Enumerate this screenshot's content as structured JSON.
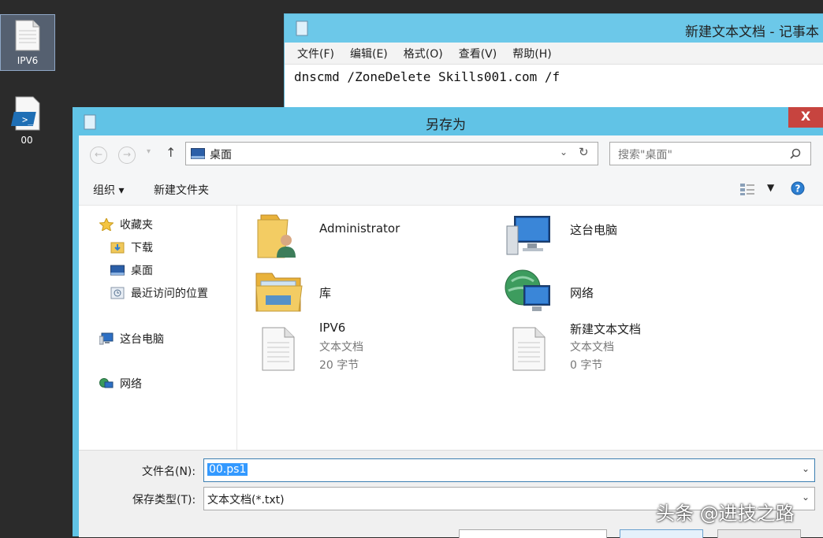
{
  "desktop": {
    "icons": [
      {
        "label": "IPV6",
        "icon": "text-file-icon"
      },
      {
        "label": "00",
        "icon": "powershell-file-icon"
      }
    ]
  },
  "notepad": {
    "title": "新建文本文档 - 记事本",
    "menu": [
      "文件(F)",
      "编辑(E)",
      "格式(O)",
      "查看(V)",
      "帮助(H)"
    ],
    "content": "dnscmd /ZoneDelete Skills001.com /f"
  },
  "dialog": {
    "title": "另存为",
    "close_label": "X",
    "address": "桌面",
    "search_placeholder": "搜索\"桌面\"",
    "toolbar": {
      "organize": "组织 ▾",
      "new_folder": "新建文件夹"
    },
    "nav": {
      "favorites": "收藏夹",
      "downloads": "下载",
      "desktop": "桌面",
      "recent": "最近访问的位置",
      "this_pc": "这台电脑",
      "network": "网络"
    },
    "items": [
      {
        "name": "Administrator"
      },
      {
        "name": "这台电脑"
      },
      {
        "name": "库"
      },
      {
        "name": "网络"
      },
      {
        "name": "IPV6",
        "type": "文本文档",
        "size": "20 字节"
      },
      {
        "name": "新建文本文档",
        "type": "文本文档",
        "size": "0 字节"
      }
    ],
    "filename_label": "文件名(N):",
    "filename_value": "00.ps1",
    "filetype_label": "保存类型(T):",
    "filetype_value": "文本文档(*.txt)"
  },
  "watermark": "头条 @进技之路",
  "colors": {
    "titlebar": "#61c3e6",
    "close": "#c7443f",
    "selection": "#3399ff"
  }
}
